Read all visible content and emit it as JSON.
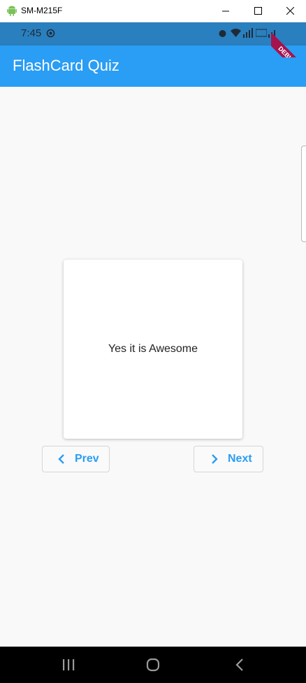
{
  "window": {
    "title": "SM-M215F"
  },
  "statusbar": {
    "time": "7:45"
  },
  "appbar": {
    "title": "FlashCard Quiz"
  },
  "debug_banner": "DEBUG",
  "card": {
    "text": "Yes it is Awesome"
  },
  "buttons": {
    "prev": "Prev",
    "next": "Next"
  },
  "colors": {
    "appbar": "#2a9df4",
    "statusbar": "#2a7fbf",
    "accent": "#2a9df4",
    "background": "#f9f9f9"
  },
  "icons": {
    "window": "android-icon",
    "prev": "chevron-left-icon",
    "next": "chevron-right-icon"
  }
}
